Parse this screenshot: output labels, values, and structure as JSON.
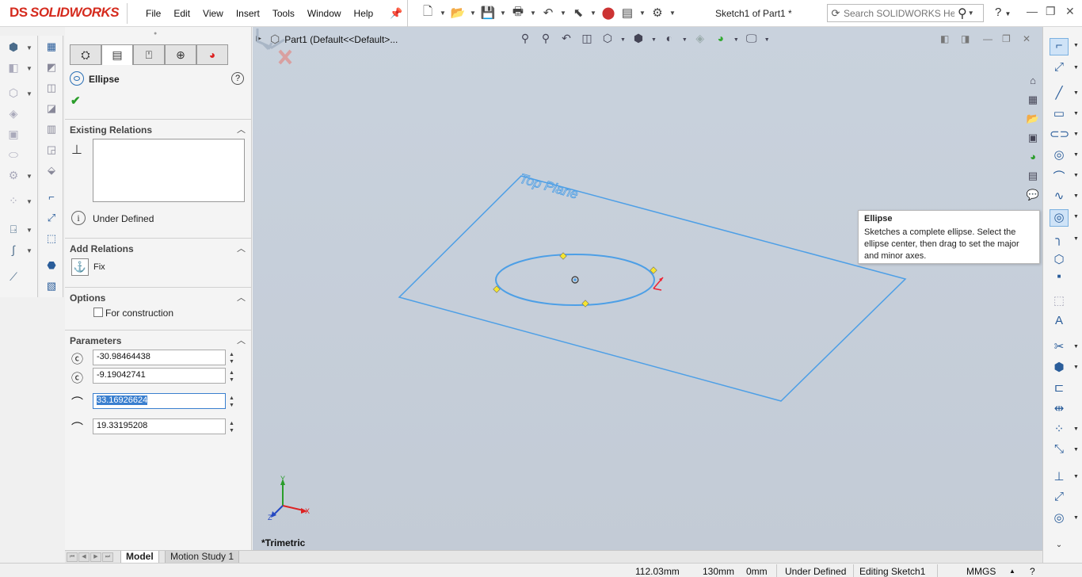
{
  "app": {
    "logo_ds": "DS",
    "logo_text": "SOLIDWORKS",
    "menu": [
      "File",
      "Edit",
      "View",
      "Insert",
      "Tools",
      "Window",
      "Help"
    ],
    "doc_title": "Sketch1 of Part1 *",
    "search_placeholder": "Search SOLIDWORKS Help",
    "help": "?"
  },
  "property_manager": {
    "title": "Ellipse",
    "help": "?",
    "ok_symbol": "✔",
    "existing_relations_label": "Existing Relations",
    "status": "Under Defined",
    "add_relations_label": "Add Relations",
    "fix_label": "Fix",
    "options_label": "Options",
    "for_construction_label": "For construction",
    "for_construction_checked": false,
    "parameters_label": "Parameters",
    "params": [
      {
        "icon": "center-x-icon",
        "value": "-30.98464438"
      },
      {
        "icon": "center-y-icon",
        "value": "-9.19042741"
      },
      {
        "icon": "major-radius-icon",
        "value": "33.16926624",
        "selected": true
      },
      {
        "icon": "minor-radius-icon",
        "value": "19.33195208"
      }
    ]
  },
  "graphics": {
    "tree_part_label": "Part1  (Default<<Default>...",
    "plane_label": "Top Plane",
    "view_name": "*Trimetric",
    "axis_labels": {
      "x": "X",
      "y": "Y",
      "z": "Z"
    },
    "sketch_color": "#4d9fe6",
    "point_color": "#f5e430"
  },
  "tooltip": {
    "title": "Ellipse",
    "body": "Sketches a complete ellipse. Select the ellipse center, then drag to set the major and minor axes."
  },
  "bottom_tabs": [
    "Model",
    "Motion Study 1"
  ],
  "active_tab": "Model",
  "status_bar": {
    "x": "112.03mm",
    "y": "130mm",
    "z": "0mm",
    "state": "Under Defined",
    "editing": "Editing Sketch1",
    "units": "MMGS"
  }
}
